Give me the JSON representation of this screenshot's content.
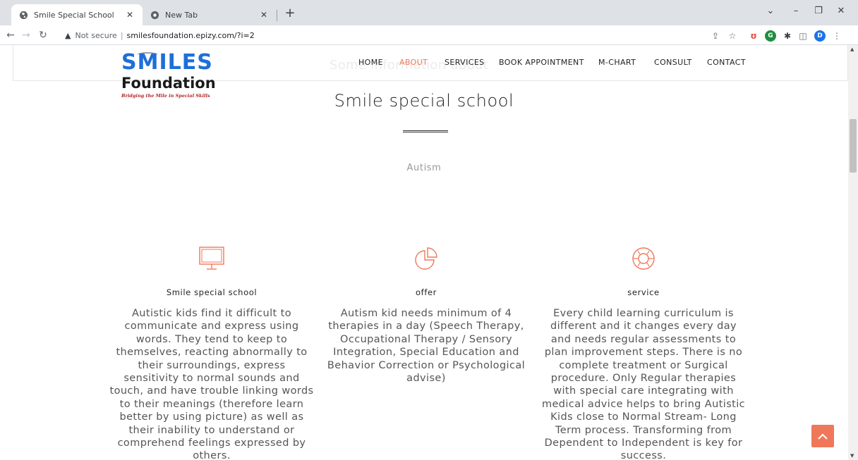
{
  "browser": {
    "tabs": [
      {
        "title": "Smile Special School",
        "active": true
      },
      {
        "title": "New Tab",
        "active": false
      }
    ],
    "address": {
      "security": "Not secure",
      "url": "smilesfoundation.epizy.com/?i=2"
    }
  },
  "site": {
    "logo": {
      "word": "SMILES",
      "sub": "Foundation",
      "tagline": "Bridging the Mile in Special Skills"
    },
    "ghost_title": "Some information about",
    "menu": [
      {
        "label": "HOME"
      },
      {
        "label": "ABOUT"
      },
      {
        "label": "SERVICES"
      },
      {
        "label": "BOOK APPOINTMENT"
      },
      {
        "label": "M-CHART"
      },
      {
        "label": "CONSULT"
      },
      {
        "label": "CONTACT"
      }
    ]
  },
  "page": {
    "title": "Smile special school",
    "subtitle": "Autism",
    "features": [
      {
        "icon": "monitor-icon",
        "title": "Smile special school",
        "text": "Autistic kids find it difficult to communicate and express using words. They tend to keep to themselves, reacting abnormally to their surroundings, express sensitivity to normal sounds and touch, and have trouble linking words to their meanings (therefore learn better by using picture) as well as their inability to understand or comprehend feelings expressed by others."
      },
      {
        "icon": "pie-chart-icon",
        "title": "offer",
        "text": "Autism kid needs minimum of 4 therapies in a day (Speech Therapy, Occupational Therapy / Sensory Integration, Special Education and Behavior Correction or Psychological advise)"
      },
      {
        "icon": "lifebuoy-icon",
        "title": "service",
        "text": "Every child learning curriculum is different and it changes every day and needs regular assessments to plan improvement steps. There is no complete treatment or Surgical procedure. Only Regular therapies with special care integrating with medical advice helps to bring Autistic Kids close to Normal Stream- Long Term process. Transforming from Dependent to Independent is key for success."
      }
    ]
  },
  "colors": {
    "accent": "#f0785a",
    "logo_blue": "#1e6fd8"
  }
}
